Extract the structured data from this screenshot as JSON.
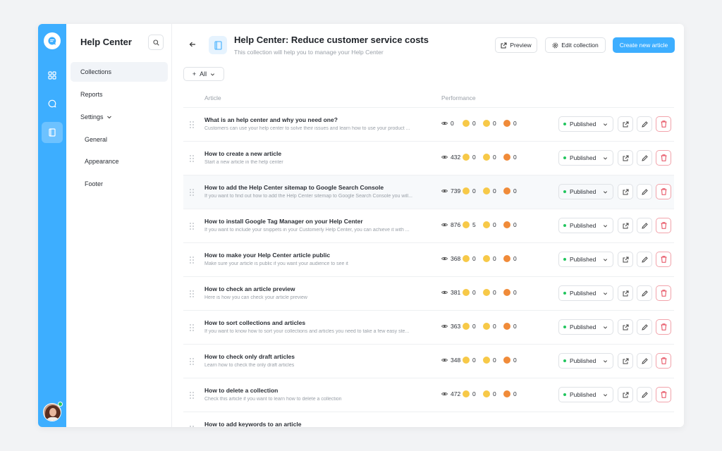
{
  "app": {
    "title": "Help Center"
  },
  "sidebar": {
    "items": [
      {
        "label": "Collections",
        "active": true
      },
      {
        "label": "Reports"
      },
      {
        "label": "Settings"
      },
      {
        "label": "General"
      },
      {
        "label": "Appearance"
      },
      {
        "label": "Footer"
      }
    ]
  },
  "header": {
    "title": "Help Center: Reduce customer service costs",
    "subtitle": "This collection will help you to manage your Help Center",
    "preview_label": "Preview",
    "edit_label": "Edit collection",
    "create_label": "Create new article"
  },
  "filter": {
    "label": "All"
  },
  "table": {
    "col_article": "Article",
    "col_performance": "Performance",
    "rows": [
      {
        "title": "What is an help center and why you need one?",
        "desc": "Customers can use your help center to solve their issues and learn how to use your product ...",
        "views": "0",
        "happy": "0",
        "neutral": "0",
        "love": "0",
        "status": "Published"
      },
      {
        "title": "How to create a new article",
        "desc": "Start a new article in the help center",
        "views": "432",
        "happy": "0",
        "neutral": "0",
        "love": "0",
        "status": "Published"
      },
      {
        "title": "How to add the Help Center sitemap to Google Search Console",
        "desc": "If you want to find out how to add the Help Center sitemap to Google Search Console you will...",
        "views": "739",
        "happy": "0",
        "neutral": "0",
        "love": "0",
        "status": "Published"
      },
      {
        "title": "How to install Google Tag Manager on your Help Center",
        "desc": "If you want to include your snippets in your Customerly Help Center, you can achieve it with ...",
        "views": "876",
        "happy": "5",
        "neutral": "0",
        "love": "0",
        "status": "Published"
      },
      {
        "title": "How to make your Help Center article public",
        "desc": "Make sure your article is public if you want your audience to see it",
        "views": "368",
        "happy": "0",
        "neutral": "0",
        "love": "0",
        "status": "Published"
      },
      {
        "title": "How to check an article preview",
        "desc": "Here is how you can check your article preview",
        "views": "381",
        "happy": "0",
        "neutral": "0",
        "love": "0",
        "status": "Published"
      },
      {
        "title": "How to sort collections and articles",
        "desc": "If you want to know how to sort your collections and articles you need to take a few easy ste...",
        "views": "363",
        "happy": "0",
        "neutral": "0",
        "love": "0",
        "status": "Published"
      },
      {
        "title": "How to check only draft articles",
        "desc": "Learn how to check the only draft articles",
        "views": "348",
        "happy": "0",
        "neutral": "0",
        "love": "0",
        "status": "Published"
      },
      {
        "title": "How to delete a collection",
        "desc": "Check this article if you want to learn how to delete a collection",
        "views": "472",
        "happy": "0",
        "neutral": "0",
        "love": "0",
        "status": "Published"
      },
      {
        "title": "How to add keywords to an article",
        "desc": "",
        "views": "",
        "happy": "",
        "neutral": "",
        "love": "",
        "status": ""
      }
    ]
  },
  "colors": {
    "accent": "#3daeff",
    "danger": "#f2a3ab",
    "published": "#22c55e"
  }
}
